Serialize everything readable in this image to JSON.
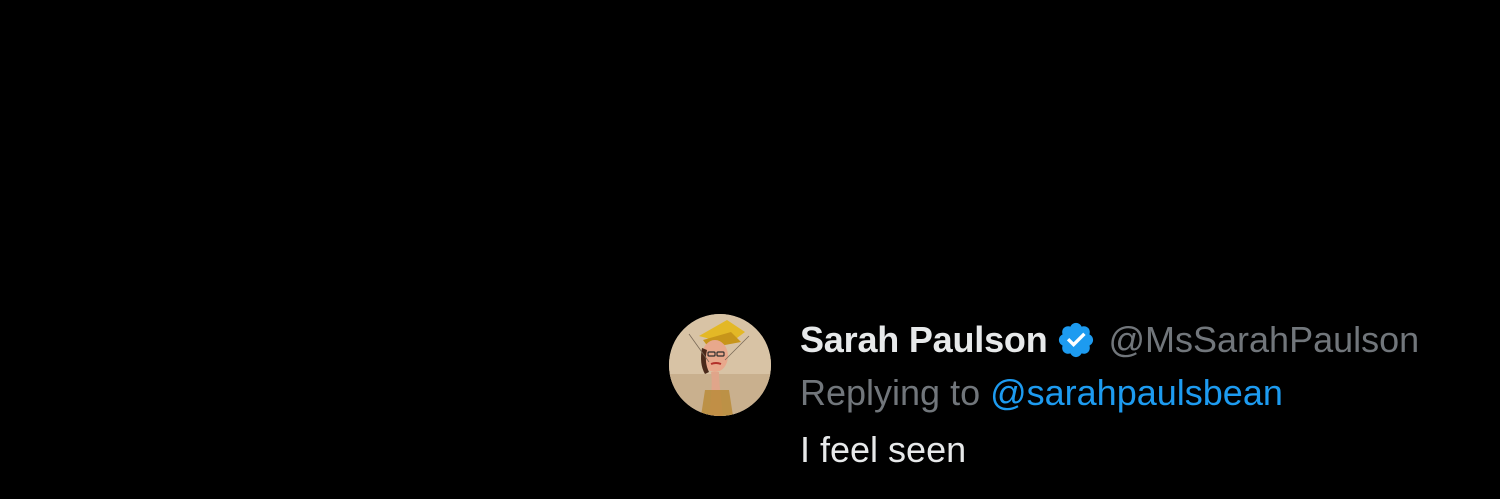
{
  "tweet": {
    "display_name": "Sarah Paulson",
    "verified_icon": "verified-badge-icon",
    "handle": "@MsSarahPaulson",
    "reply_prefix": "Replying to",
    "reply_to_handle": "@sarahpaulsbean",
    "text": "I feel seen"
  },
  "colors": {
    "background": "#000000",
    "name": "#e7e9ea",
    "muted": "#71767b",
    "link": "#1d9bf0",
    "verified": "#1d9bf0"
  }
}
